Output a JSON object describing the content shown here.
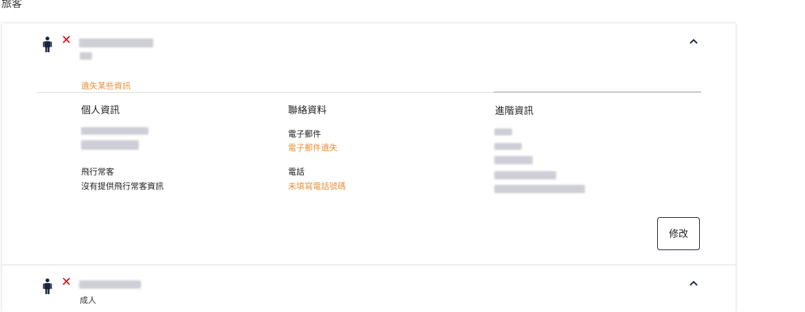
{
  "page": {
    "title": "旅客"
  },
  "passengers": [
    {
      "status_icon": "close-icon",
      "expanded": true,
      "warning": "遺失某些資訊",
      "sections": {
        "personal": {
          "title": "個人資訊",
          "frequent_flyer_label": "飛行常客",
          "frequent_flyer_value": "沒有提供飛行常客資訊"
        },
        "contact": {
          "title": "聯絡資料",
          "email_label": "電子郵件",
          "email_value": "電子郵件遺失",
          "phone_label": "電話",
          "phone_value": "未填寫電話號碼"
        },
        "advanced": {
          "title": "進階資訊"
        }
      },
      "edit_label": "修改"
    },
    {
      "status_icon": "close-icon",
      "expanded": false,
      "type_label": "成人"
    }
  ],
  "colors": {
    "error": "#d0021b",
    "warning": "#e8923b",
    "icon": "#1a2440"
  }
}
